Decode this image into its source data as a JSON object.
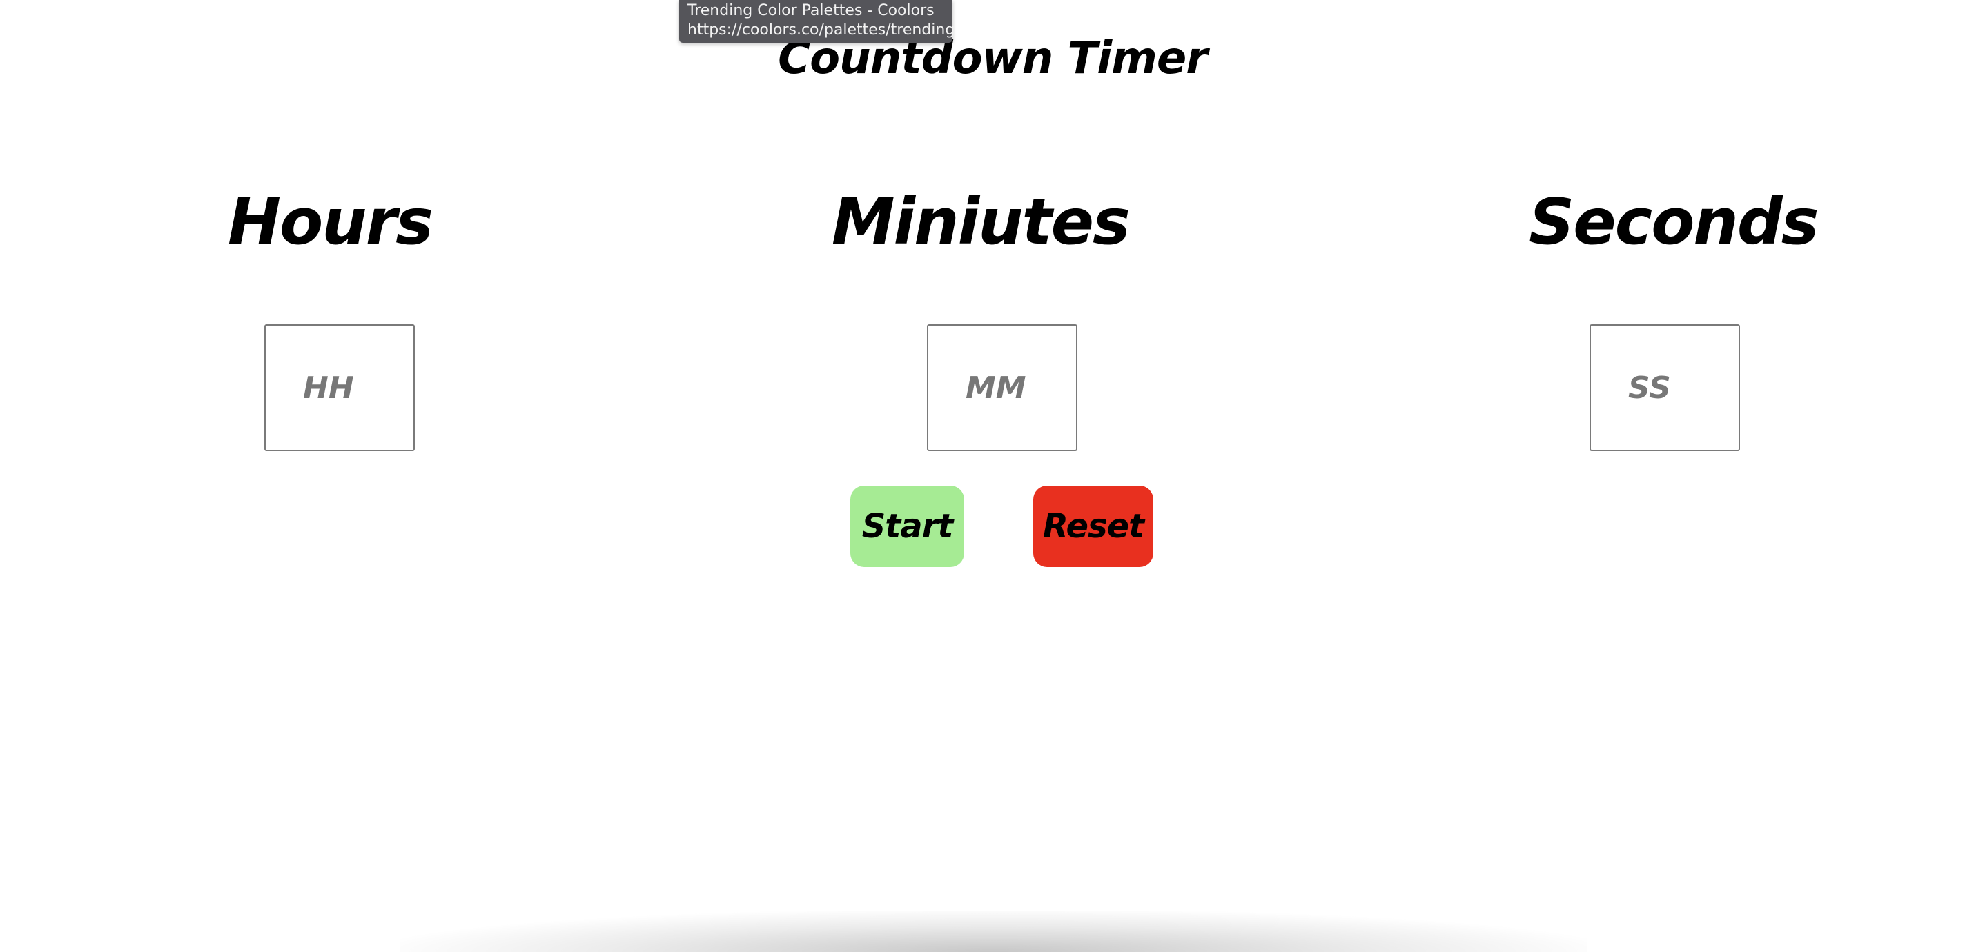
{
  "tooltip": {
    "title": "Trending Color Palettes - Coolors",
    "url": "https://coolors.co/palettes/trending"
  },
  "app": {
    "title": "Countdown Timer"
  },
  "units": {
    "hours": {
      "label": "Hours",
      "placeholder": "HH",
      "value": ""
    },
    "minutes": {
      "label": "Miniutes",
      "placeholder": "MM",
      "value": ""
    },
    "seconds": {
      "label": "Seconds",
      "placeholder": "SS",
      "value": ""
    }
  },
  "controls": {
    "start_label": "Start",
    "reset_label": "Reset"
  },
  "colors": {
    "start_button": "#a6eb94",
    "reset_button": "#e8301f",
    "tooltip_bg": "#55555a"
  }
}
